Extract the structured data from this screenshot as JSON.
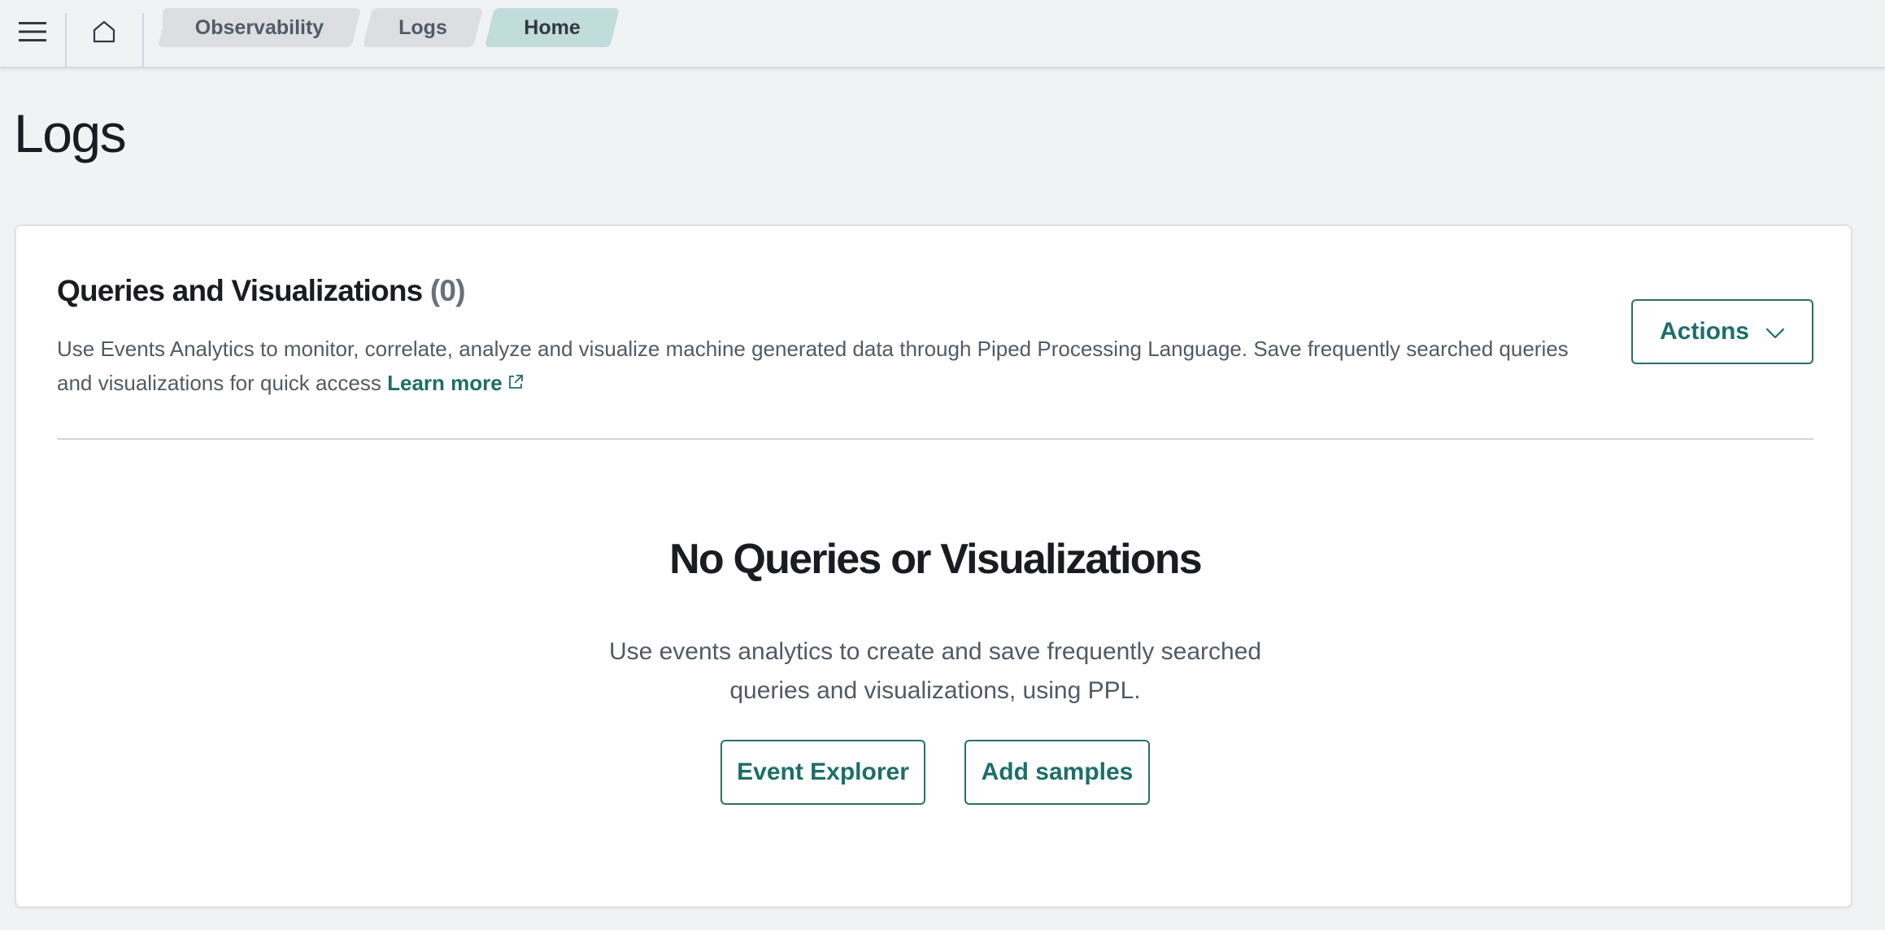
{
  "header": {
    "menu_icon": "hamburger-menu-icon",
    "home_icon": "home-icon",
    "breadcrumbs": [
      {
        "label": "Observability"
      },
      {
        "label": "Logs"
      },
      {
        "label": "Home"
      }
    ]
  },
  "page": {
    "title": "Logs"
  },
  "panel": {
    "title": "Queries and Visualizations",
    "count": "(0)",
    "description": "Use Events Analytics to monitor, correlate, analyze and visualize machine generated data through Piped Processing Language. Save frequently searched queries and visualizations for quick access",
    "learn_more": "Learn more",
    "actions_label": "Actions"
  },
  "empty_state": {
    "title": "No Queries or Visualizations",
    "description": "Use events analytics to create and save frequently searched queries and visualizations, using PPL.",
    "event_explorer_label": "Event Explorer",
    "add_samples_label": "Add samples"
  },
  "colors": {
    "accent": "#1d6e68",
    "active_breadcrumb": "#c0dcdb",
    "background": "#f1f2f4"
  }
}
